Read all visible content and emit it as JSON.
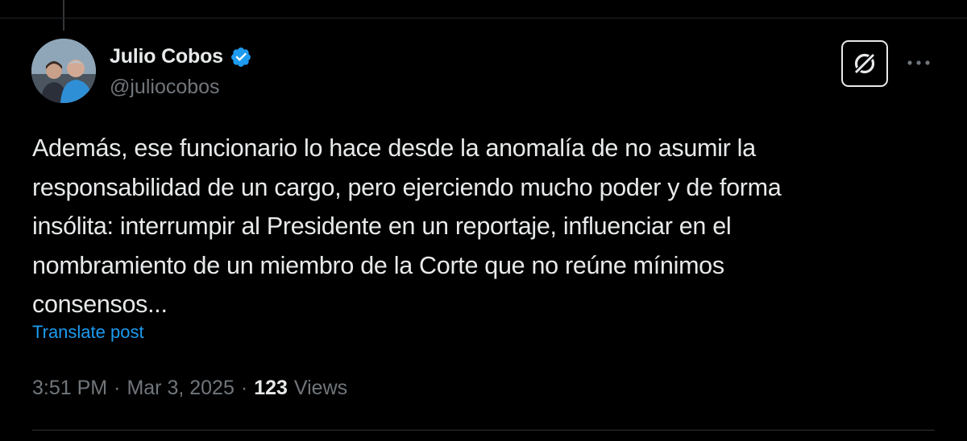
{
  "post": {
    "author": {
      "display_name": "Julio Cobos",
      "handle": "@juliocobos",
      "verified": true,
      "avatar_icon": "profile-photo"
    },
    "text_lines": [
      "Además, ese funcionario lo hace desde la anomalía de no asumir la",
      "responsabilidad de un cargo, pero ejerciendo mucho poder y de forma",
      "insólita: interrumpir al Presidente en un reportaje, influenciar en el",
      "nombramiento de un miembro de la Corte que no reúne mínimos",
      "consensos..."
    ],
    "translate_label": "Translate post",
    "time": "3:51 PM",
    "date": "Mar 3, 2025",
    "separator": "·",
    "views_count": "123",
    "views_label": "Views"
  },
  "actions": {
    "grok_icon": "grok-icon",
    "more_icon": "more-icon"
  },
  "colors": {
    "background": "#000000",
    "text_primary": "#e7e9ea",
    "text_secondary": "#71767b",
    "link": "#1d9bf0",
    "verified": "#1d9bf0"
  }
}
